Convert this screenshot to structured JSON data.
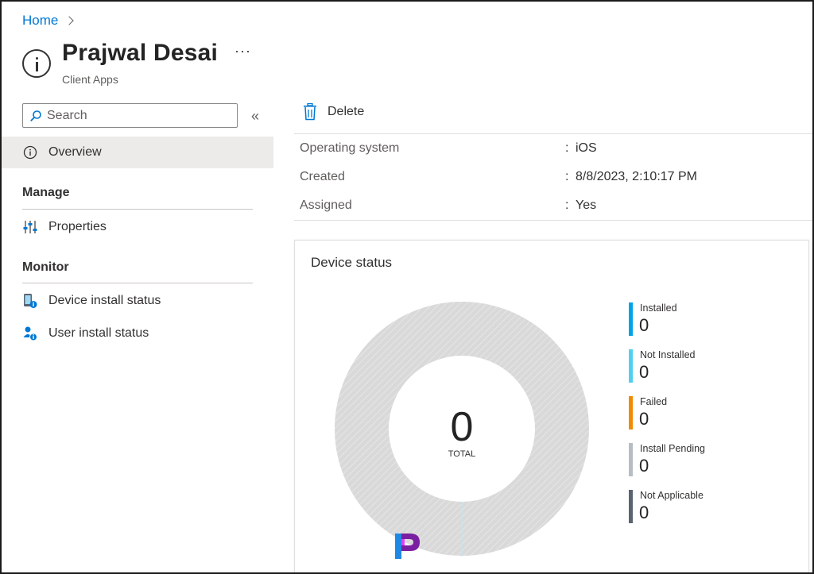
{
  "breadcrumb": {
    "home": "Home"
  },
  "header": {
    "title": "Prajwal Desai",
    "more": "···",
    "subtitle": "Client Apps"
  },
  "sidebar": {
    "search_placeholder": "Search",
    "collapse": "«",
    "overview": "Overview",
    "manage_heading": "Manage",
    "properties": "Properties",
    "monitor_heading": "Monitor",
    "device_install_status": "Device install status",
    "user_install_status": "User install status"
  },
  "toolbar": {
    "delete_label": "Delete"
  },
  "properties": [
    {
      "label": "Operating system",
      "value": "iOS"
    },
    {
      "label": "Created",
      "value": "8/8/2023, 2:10:17 PM"
    },
    {
      "label": "Assigned",
      "value": "Yes"
    }
  ],
  "device_status": {
    "title": "Device status",
    "total_value": "0",
    "total_label": "TOTAL",
    "legend": [
      {
        "label": "Installed",
        "value": "0",
        "color": "#00a2e8"
      },
      {
        "label": "Not Installed",
        "value": "0",
        "color": "#50d0f0"
      },
      {
        "label": "Failed",
        "value": "0",
        "color": "#f08a00"
      },
      {
        "label": "Install Pending",
        "value": "0",
        "color": "#b8bdc4"
      },
      {
        "label": "Not Applicable",
        "value": "0",
        "color": "#5a6470"
      }
    ]
  },
  "colors": {
    "accent": "#0078d4",
    "donut_empty": "#d9d9d9"
  }
}
